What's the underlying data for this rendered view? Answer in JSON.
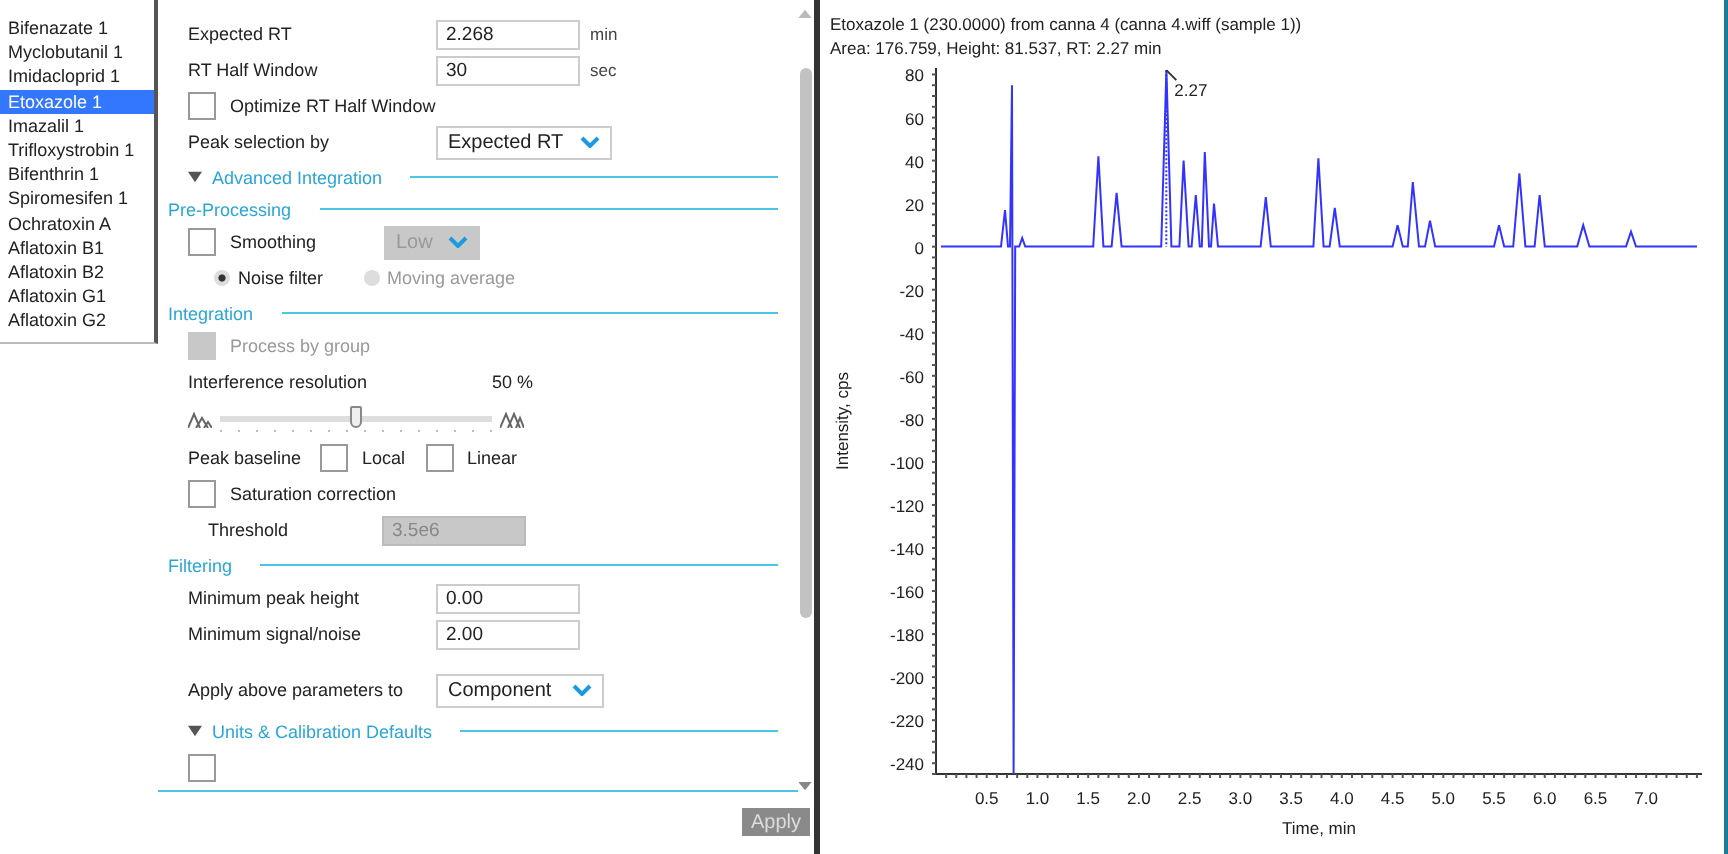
{
  "components": [
    {
      "name": "Bifenazate 1",
      "selected": false
    },
    {
      "name": "Myclobutanil 1",
      "selected": false
    },
    {
      "name": "Imidacloprid 1",
      "selected": false
    },
    {
      "name": "Etoxazole 1",
      "selected": true
    },
    {
      "name": "Imazalil 1",
      "selected": false
    },
    {
      "name": "Trifloxystrobin 1",
      "selected": false
    },
    {
      "name": "Bifenthrin 1",
      "selected": false
    },
    {
      "name": "Spiromesifen 1",
      "selected": false
    },
    {
      "name": "Ochratoxin A",
      "selected": false
    },
    {
      "name": "Aflatoxin B1",
      "selected": false
    },
    {
      "name": "Aflatoxin B2",
      "selected": false
    },
    {
      "name": "Aflatoxin G1",
      "selected": false
    },
    {
      "name": "Aflatoxin G2",
      "selected": false
    }
  ],
  "settings": {
    "rows": [
      {
        "kind": "field",
        "label": "Expected RT",
        "value": "2.268",
        "unit": "min"
      },
      {
        "kind": "field",
        "label": "RT Half Window",
        "value": "30",
        "unit": "sec"
      },
      {
        "kind": "checkbox",
        "label": "Optimize RT Half Window",
        "checked": false,
        "disabled": false
      },
      {
        "kind": "dropdown",
        "label": "Peak selection by",
        "value": "Expected RT"
      },
      {
        "kind": "group",
        "label": "Advanced Integration",
        "expanded": true
      },
      {
        "kind": "section",
        "label": "Pre-Processing"
      },
      {
        "kind": "checkbox_dropdown",
        "label": "Smoothing",
        "checked": false,
        "value": "Low",
        "disabled": true
      },
      {
        "kind": "radios",
        "options": [
          {
            "label": "Noise filter",
            "selected": true
          },
          {
            "label": "Moving average",
            "selected": false
          }
        ]
      },
      {
        "kind": "section",
        "label": "Integration"
      },
      {
        "kind": "checkbox",
        "label": "Process by group",
        "checked": false,
        "disabled": true
      },
      {
        "kind": "slider",
        "label": "Interference resolution",
        "reading": "50 %",
        "level": 0.5
      },
      {
        "kind": "checks",
        "label": "Peak baseline",
        "options": [
          {
            "label": "Local",
            "checked": false
          },
          {
            "label": "Linear",
            "checked": false
          }
        ]
      },
      {
        "kind": "checkbox",
        "label": "Saturation correction",
        "checked": false,
        "disabled": false
      },
      {
        "kind": "subfield",
        "label": "Threshold",
        "value": "3.5e6",
        "disabled": true
      },
      {
        "kind": "section",
        "label": "Filtering"
      },
      {
        "kind": "field",
        "label": "Minimum peak height",
        "value": "0.00"
      },
      {
        "kind": "field",
        "label": "Minimum signal/noise",
        "value": "2.00"
      },
      {
        "kind": "scope_dropdown",
        "label": "Apply above parameters to",
        "value": "Component"
      },
      {
        "kind": "group",
        "label": "Units & Calibration Defaults",
        "expanded": true
      },
      {
        "kind": "cut_checkbox",
        "checked": false
      }
    ],
    "apply_button": {
      "label": "Apply",
      "disabled": true
    }
  },
  "chromatogram": {
    "title": "Etoxazole 1 (230.0000) from canna 4 (canna 4.wiff (sample 1))",
    "subtitle": "Area: 176.759, Height: 81.537, RT: 2.27 min",
    "chart_data": {
      "type": "line",
      "xlabel": "Time, min",
      "ylabel": "Intensity, cps",
      "x": [
        0.05,
        0.64,
        0.68,
        0.71,
        0.73,
        0.75,
        0.765,
        0.78,
        0.82,
        0.85,
        0.88,
        1.55,
        1.6,
        1.65,
        1.73,
        1.78,
        1.83,
        2.22,
        2.27,
        2.32,
        2.4,
        2.44,
        2.49,
        2.52,
        2.56,
        2.6,
        2.62,
        2.65,
        2.69,
        2.71,
        2.74,
        2.78,
        3.2,
        3.25,
        3.3,
        3.72,
        3.77,
        3.82,
        3.88,
        3.93,
        3.98,
        4.5,
        4.55,
        4.6,
        4.65,
        4.7,
        4.76,
        4.82,
        4.87,
        4.92,
        5.5,
        5.55,
        5.6,
        5.69,
        5.75,
        5.81,
        5.9,
        5.95,
        6.0,
        6.32,
        6.38,
        6.44,
        6.8,
        6.85,
        6.9,
        7.5
      ],
      "series": [
        {
          "color": "#3333ff",
          "values": [
            0,
            0,
            17,
            0,
            0,
            75,
            -245,
            0,
            0,
            4,
            0,
            0,
            42,
            0,
            0,
            25,
            0,
            0,
            82,
            0,
            0,
            40,
            0,
            0,
            24,
            0,
            0,
            44,
            0,
            0,
            20,
            0,
            0,
            23,
            0,
            0,
            41,
            0,
            0,
            18,
            0,
            0,
            10,
            0,
            0,
            30,
            0,
            0,
            12,
            0,
            0,
            10,
            0,
            0,
            34,
            0,
            0,
            24,
            0,
            0,
            10,
            0,
            0,
            7,
            0,
            0
          ]
        }
      ],
      "xlim": [
        0,
        7.55
      ],
      "ylim": [
        -245,
        83
      ],
      "xticks": [
        {
          "value": 0.5,
          "label": "0.5"
        },
        {
          "value": 1,
          "label": "1.0"
        },
        {
          "value": 1.5,
          "label": "1.5"
        },
        {
          "value": 2,
          "label": "2.0"
        },
        {
          "value": 2.5,
          "label": "2.5"
        },
        {
          "value": 3,
          "label": "3.0"
        },
        {
          "value": 3.5,
          "label": "3.5"
        },
        {
          "value": 4,
          "label": "4.0"
        },
        {
          "value": 4.5,
          "label": "4.5"
        },
        {
          "value": 5,
          "label": "5.0"
        },
        {
          "value": 5.5,
          "label": "5.5"
        },
        {
          "value": 6,
          "label": "6.0"
        },
        {
          "value": 6.5,
          "label": "6.5"
        },
        {
          "value": 7,
          "label": "7.0"
        }
      ],
      "yticks": [
        80,
        60,
        40,
        20,
        0,
        -20,
        -40,
        -60,
        -80,
        -100,
        -120,
        -140,
        -160,
        -180,
        -200,
        -220,
        -240
      ],
      "annotations": [
        {
          "x": 2.27,
          "y": 82,
          "text": "2.27"
        }
      ]
    }
  }
}
